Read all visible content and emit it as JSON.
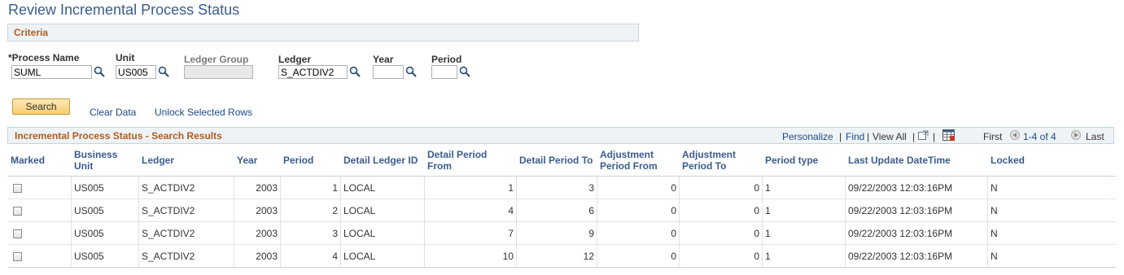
{
  "page": {
    "title": "Review Incremental Process Status"
  },
  "criteria": {
    "header": "Criteria",
    "process_name": {
      "label": "*Process Name",
      "value": "SUML"
    },
    "unit": {
      "label": "Unit",
      "value": "US005"
    },
    "ledger_group": {
      "label": "Ledger Group",
      "value": ""
    },
    "ledger": {
      "label": "Ledger",
      "value": "S_ACTDIV2"
    },
    "year": {
      "label": "Year",
      "value": ""
    },
    "period": {
      "label": "Period",
      "value": ""
    }
  },
  "actions": {
    "search": "Search",
    "clear_data": "Clear Data",
    "unlock_rows": "Unlock Selected Rows"
  },
  "grid": {
    "title": "Incremental Process Status - Search Results",
    "personalize": "Personalize",
    "sep1": "|",
    "find": "Find",
    "sep2": "|",
    "view_all": "View All",
    "sep3": "|",
    "sep4": "|",
    "first": "First",
    "range": "1-4 of 4",
    "last": "Last",
    "columns": {
      "marked": "Marked",
      "business_unit": "Business Unit",
      "ledger": "Ledger",
      "year": "Year",
      "period": "Period",
      "detail_ledger_id": "Detail Ledger ID",
      "detail_period_from": "Detail Period From",
      "detail_period_to": "Detail Period To",
      "adjustment_period_from": "Adjustment Period From",
      "adjustment_period_to": "Adjustment Period To",
      "period_type": "Period type",
      "last_update": "Last Update DateTime",
      "locked": "Locked"
    },
    "rows": [
      {
        "unit": "US005",
        "ledger": "S_ACTDIV2",
        "year": "2003",
        "period": "1",
        "detail_ledger": "LOCAL",
        "dp_from": "1",
        "dp_to": "3",
        "adj_from": "0",
        "adj_to": "0",
        "period_type": "1",
        "updated": "09/22/2003 12:03:16PM",
        "locked": "N"
      },
      {
        "unit": "US005",
        "ledger": "S_ACTDIV2",
        "year": "2003",
        "period": "2",
        "detail_ledger": "LOCAL",
        "dp_from": "4",
        "dp_to": "6",
        "adj_from": "0",
        "adj_to": "0",
        "period_type": "1",
        "updated": "09/22/2003 12:03:16PM",
        "locked": "N"
      },
      {
        "unit": "US005",
        "ledger": "S_ACTDIV2",
        "year": "2003",
        "period": "3",
        "detail_ledger": "LOCAL",
        "dp_from": "7",
        "dp_to": "9",
        "adj_from": "0",
        "adj_to": "0",
        "period_type": "1",
        "updated": "09/22/2003 12:03:16PM",
        "locked": "N"
      },
      {
        "unit": "US005",
        "ledger": "S_ACTDIV2",
        "year": "2003",
        "period": "4",
        "detail_ledger": "LOCAL",
        "dp_from": "10",
        "dp_to": "12",
        "adj_from": "0",
        "adj_to": "0",
        "period_type": "1",
        "updated": "09/22/2003 12:03:16PM",
        "locked": "N"
      }
    ]
  },
  "icons": {
    "lookup": "magnifier-lookup-icon",
    "zoom": "zoom-grid-icon",
    "download": "download-excel-icon",
    "prev": "previous-arrow-icon",
    "next": "next-arrow-icon"
  },
  "colors": {
    "title": "#3a5c8e",
    "section_header": "#b25c1f",
    "link": "#1b4a8b",
    "button": "#f6cd71"
  }
}
